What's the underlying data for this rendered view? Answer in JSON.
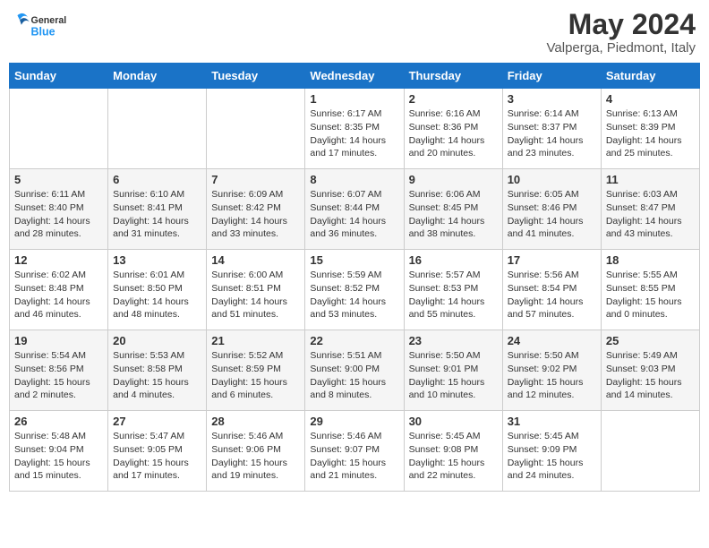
{
  "header": {
    "logo_general": "General",
    "logo_blue": "Blue",
    "month_title": "May 2024",
    "location": "Valperga, Piedmont, Italy"
  },
  "days_of_week": [
    "Sunday",
    "Monday",
    "Tuesday",
    "Wednesday",
    "Thursday",
    "Friday",
    "Saturday"
  ],
  "weeks": [
    [
      {
        "day": "",
        "info": ""
      },
      {
        "day": "",
        "info": ""
      },
      {
        "day": "",
        "info": ""
      },
      {
        "day": "1",
        "info": "Sunrise: 6:17 AM\nSunset: 8:35 PM\nDaylight: 14 hours\nand 17 minutes."
      },
      {
        "day": "2",
        "info": "Sunrise: 6:16 AM\nSunset: 8:36 PM\nDaylight: 14 hours\nand 20 minutes."
      },
      {
        "day": "3",
        "info": "Sunrise: 6:14 AM\nSunset: 8:37 PM\nDaylight: 14 hours\nand 23 minutes."
      },
      {
        "day": "4",
        "info": "Sunrise: 6:13 AM\nSunset: 8:39 PM\nDaylight: 14 hours\nand 25 minutes."
      }
    ],
    [
      {
        "day": "5",
        "info": "Sunrise: 6:11 AM\nSunset: 8:40 PM\nDaylight: 14 hours\nand 28 minutes."
      },
      {
        "day": "6",
        "info": "Sunrise: 6:10 AM\nSunset: 8:41 PM\nDaylight: 14 hours\nand 31 minutes."
      },
      {
        "day": "7",
        "info": "Sunrise: 6:09 AM\nSunset: 8:42 PM\nDaylight: 14 hours\nand 33 minutes."
      },
      {
        "day": "8",
        "info": "Sunrise: 6:07 AM\nSunset: 8:44 PM\nDaylight: 14 hours\nand 36 minutes."
      },
      {
        "day": "9",
        "info": "Sunrise: 6:06 AM\nSunset: 8:45 PM\nDaylight: 14 hours\nand 38 minutes."
      },
      {
        "day": "10",
        "info": "Sunrise: 6:05 AM\nSunset: 8:46 PM\nDaylight: 14 hours\nand 41 minutes."
      },
      {
        "day": "11",
        "info": "Sunrise: 6:03 AM\nSunset: 8:47 PM\nDaylight: 14 hours\nand 43 minutes."
      }
    ],
    [
      {
        "day": "12",
        "info": "Sunrise: 6:02 AM\nSunset: 8:48 PM\nDaylight: 14 hours\nand 46 minutes."
      },
      {
        "day": "13",
        "info": "Sunrise: 6:01 AM\nSunset: 8:50 PM\nDaylight: 14 hours\nand 48 minutes."
      },
      {
        "day": "14",
        "info": "Sunrise: 6:00 AM\nSunset: 8:51 PM\nDaylight: 14 hours\nand 51 minutes."
      },
      {
        "day": "15",
        "info": "Sunrise: 5:59 AM\nSunset: 8:52 PM\nDaylight: 14 hours\nand 53 minutes."
      },
      {
        "day": "16",
        "info": "Sunrise: 5:57 AM\nSunset: 8:53 PM\nDaylight: 14 hours\nand 55 minutes."
      },
      {
        "day": "17",
        "info": "Sunrise: 5:56 AM\nSunset: 8:54 PM\nDaylight: 14 hours\nand 57 minutes."
      },
      {
        "day": "18",
        "info": "Sunrise: 5:55 AM\nSunset: 8:55 PM\nDaylight: 15 hours\nand 0 minutes."
      }
    ],
    [
      {
        "day": "19",
        "info": "Sunrise: 5:54 AM\nSunset: 8:56 PM\nDaylight: 15 hours\nand 2 minutes."
      },
      {
        "day": "20",
        "info": "Sunrise: 5:53 AM\nSunset: 8:58 PM\nDaylight: 15 hours\nand 4 minutes."
      },
      {
        "day": "21",
        "info": "Sunrise: 5:52 AM\nSunset: 8:59 PM\nDaylight: 15 hours\nand 6 minutes."
      },
      {
        "day": "22",
        "info": "Sunrise: 5:51 AM\nSunset: 9:00 PM\nDaylight: 15 hours\nand 8 minutes."
      },
      {
        "day": "23",
        "info": "Sunrise: 5:50 AM\nSunset: 9:01 PM\nDaylight: 15 hours\nand 10 minutes."
      },
      {
        "day": "24",
        "info": "Sunrise: 5:50 AM\nSunset: 9:02 PM\nDaylight: 15 hours\nand 12 minutes."
      },
      {
        "day": "25",
        "info": "Sunrise: 5:49 AM\nSunset: 9:03 PM\nDaylight: 15 hours\nand 14 minutes."
      }
    ],
    [
      {
        "day": "26",
        "info": "Sunrise: 5:48 AM\nSunset: 9:04 PM\nDaylight: 15 hours\nand 15 minutes."
      },
      {
        "day": "27",
        "info": "Sunrise: 5:47 AM\nSunset: 9:05 PM\nDaylight: 15 hours\nand 17 minutes."
      },
      {
        "day": "28",
        "info": "Sunrise: 5:46 AM\nSunset: 9:06 PM\nDaylight: 15 hours\nand 19 minutes."
      },
      {
        "day": "29",
        "info": "Sunrise: 5:46 AM\nSunset: 9:07 PM\nDaylight: 15 hours\nand 21 minutes."
      },
      {
        "day": "30",
        "info": "Sunrise: 5:45 AM\nSunset: 9:08 PM\nDaylight: 15 hours\nand 22 minutes."
      },
      {
        "day": "31",
        "info": "Sunrise: 5:45 AM\nSunset: 9:09 PM\nDaylight: 15 hours\nand 24 minutes."
      },
      {
        "day": "",
        "info": ""
      }
    ]
  ]
}
